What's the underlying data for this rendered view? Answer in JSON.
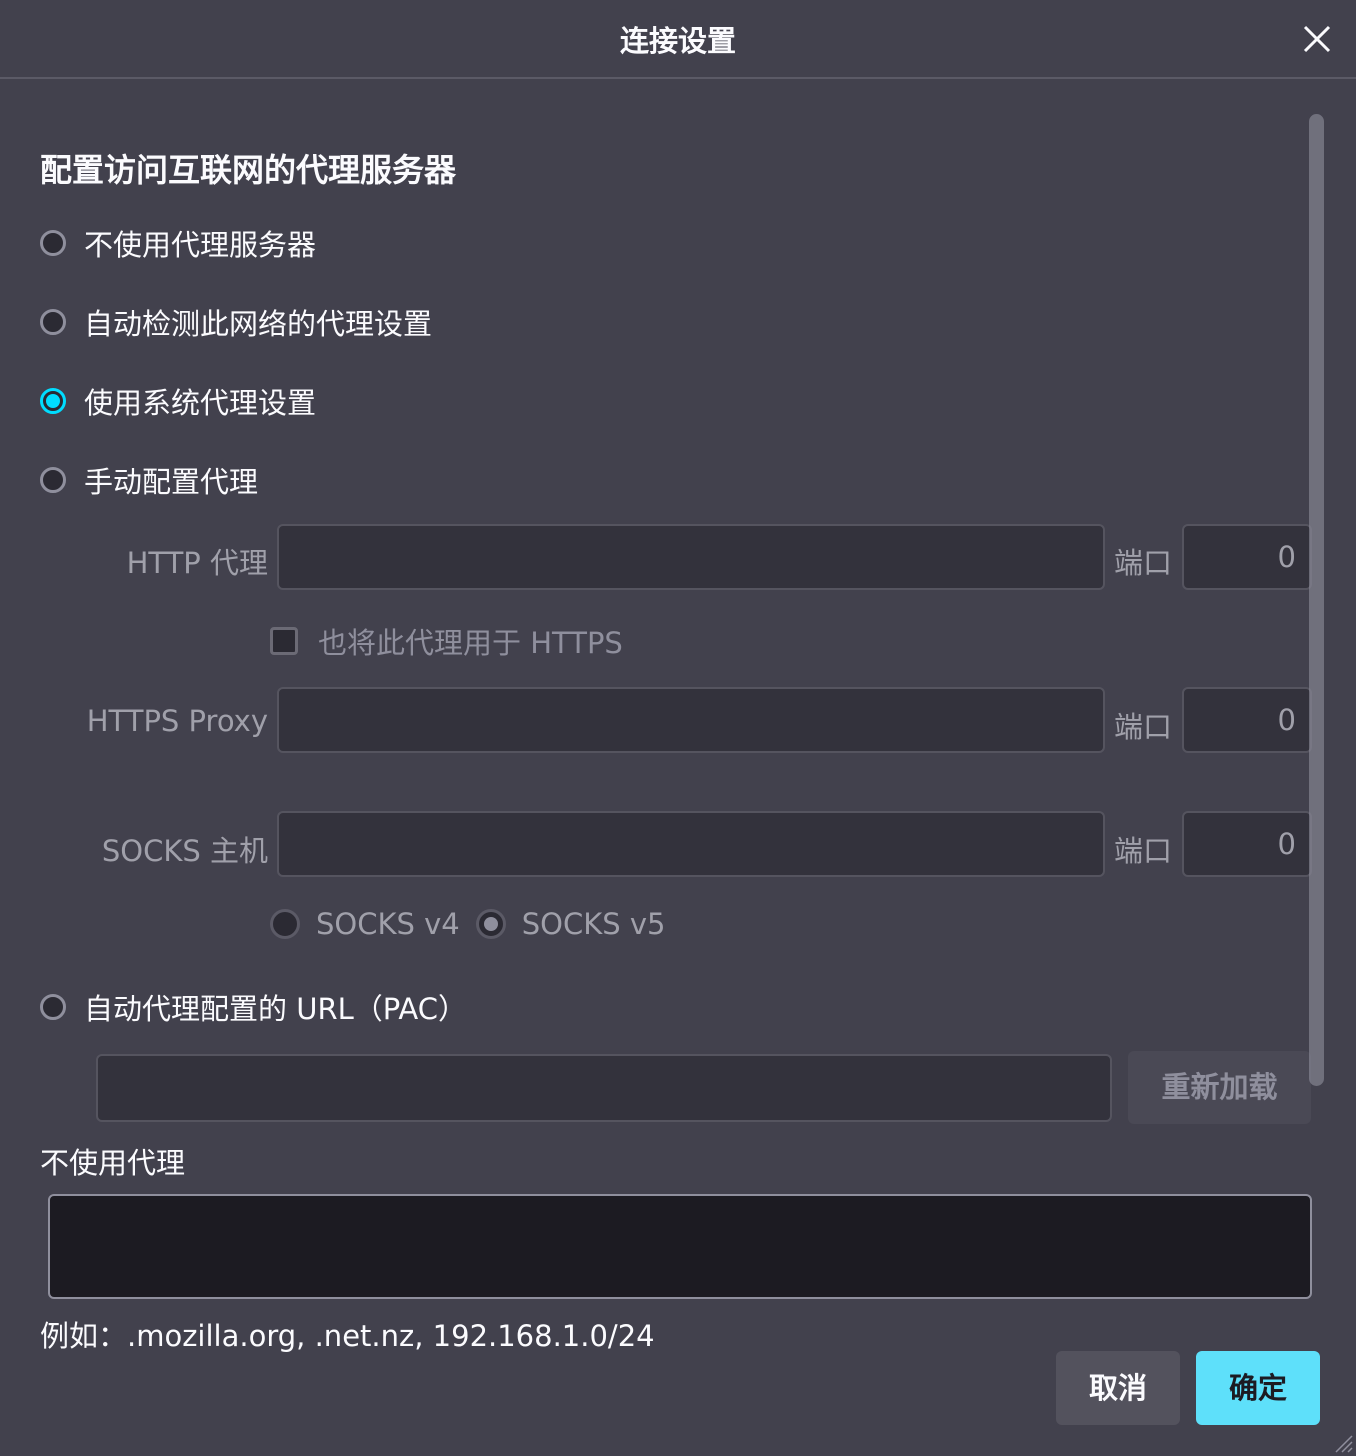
{
  "window": {
    "title": "连接设置"
  },
  "section": {
    "title": "配置访问互联网的代理服务器"
  },
  "proxy_options": [
    {
      "label": "不使用代理服务器",
      "checked": false
    },
    {
      "label": "自动检测此网络的代理设置",
      "checked": false
    },
    {
      "label": "使用系统代理设置",
      "checked": true
    },
    {
      "label": "手动配置代理",
      "checked": false
    }
  ],
  "manual": {
    "http_label": "HTTP 代理",
    "http_value": "",
    "port_label": "端口",
    "http_port": "0",
    "also_https_label": "也将此代理用于 HTTPS",
    "also_https_checked": false,
    "https_label": "HTTPS Proxy",
    "https_value": "",
    "https_port": "0",
    "socks_label": "SOCKS 主机",
    "socks_value": "",
    "socks_port": "0",
    "socks_v4_label": "SOCKS v4",
    "socks_v5_label": "SOCKS v5",
    "socks_selected": "SOCKS v5"
  },
  "pac": {
    "label": "自动代理配置的 URL（PAC）",
    "checked": false,
    "value": "",
    "reload_label": "重新加载"
  },
  "no_proxy": {
    "label": "不使用代理",
    "value": "",
    "example": "例如：.mozilla.org, .net.nz, 192.168.1.0/24"
  },
  "buttons": {
    "cancel": "取消",
    "ok": "确定"
  },
  "colors": {
    "background": "#42414d",
    "accent": "#00ddff",
    "ok_button": "#5ee0fa",
    "text": "#fbfbfe",
    "dim_text": "#a0a0aa"
  }
}
